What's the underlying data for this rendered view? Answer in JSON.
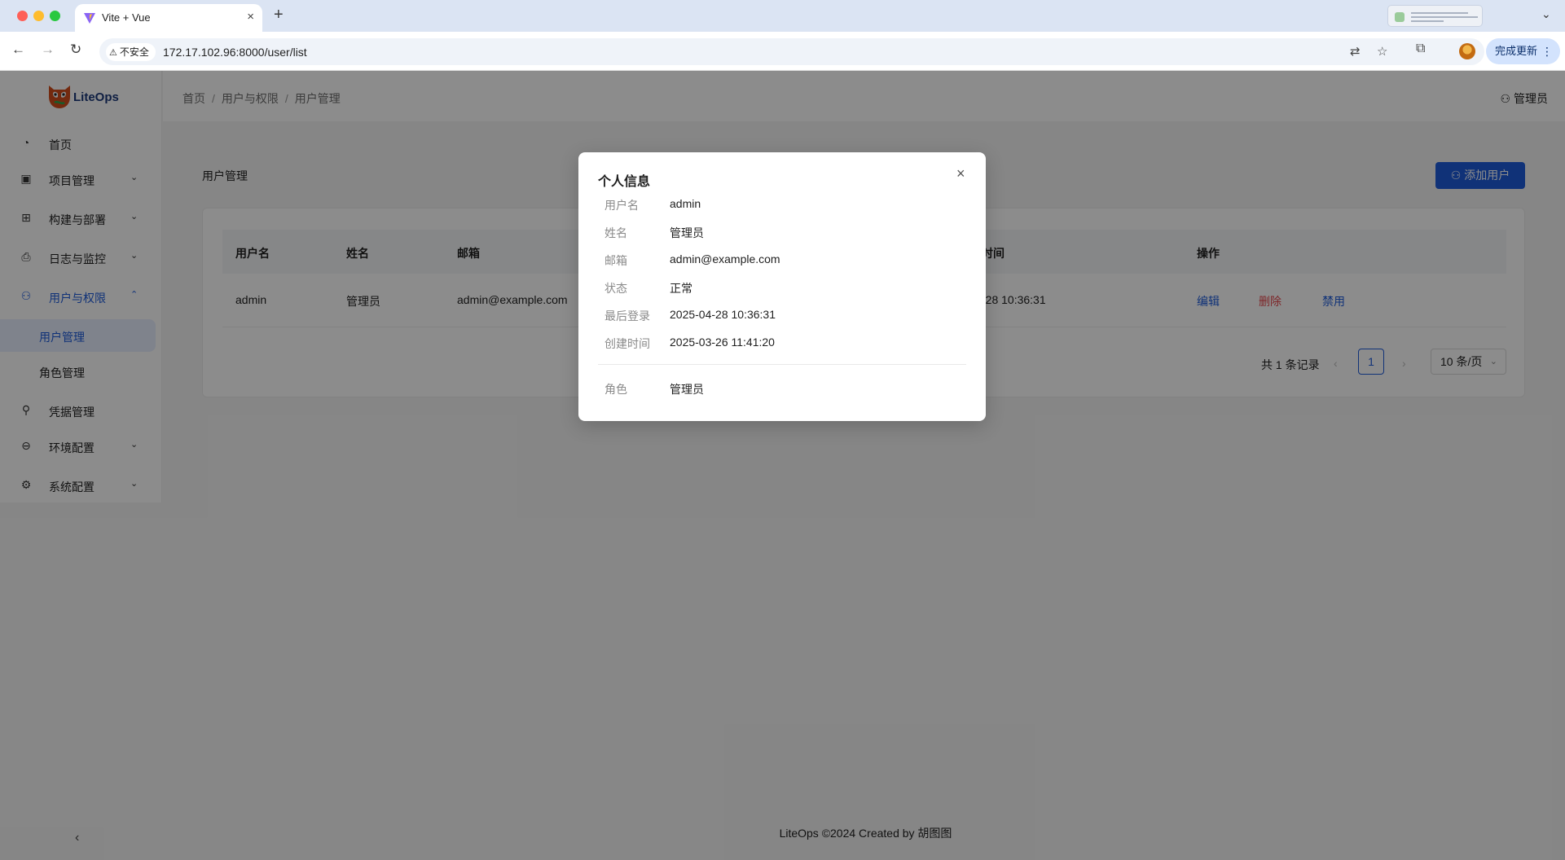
{
  "browser": {
    "tab_title": "Vite + Vue",
    "new_tab": "+",
    "tab_close": "×",
    "url": "172.17.102.96:8000/user/list",
    "insecure_label": "不安全",
    "update_label": "完成更新",
    "icons": [
      "back-icon",
      "forward-icon",
      "reload-icon",
      "translate-icon",
      "star-icon",
      "extensions-icon",
      "profile-icon",
      "menu-dots-icon"
    ]
  },
  "app": {
    "logo_text": "LiteOps",
    "breadcrumb": [
      "首页",
      "用户与权限",
      "用户管理"
    ],
    "breadcrumb_sep": "/",
    "user_menu": "管理员",
    "footer": "LiteOps ©2024 Created by 胡图图"
  },
  "sidebar": {
    "items": [
      {
        "label": "首页",
        "icon": "dashboard-icon"
      },
      {
        "label": "项目管理",
        "icon": "project-icon"
      },
      {
        "label": "构建与部署",
        "icon": "build-icon"
      },
      {
        "label": "日志与监控",
        "icon": "log-icon"
      },
      {
        "label": "用户与权限",
        "icon": "user-icon"
      },
      {
        "label": "凭据管理",
        "icon": "key-icon"
      },
      {
        "label": "环境配置",
        "icon": "environment-icon"
      },
      {
        "label": "系统配置",
        "icon": "settings-icon"
      }
    ],
    "subitems": [
      {
        "label": "用户管理",
        "selected": true
      },
      {
        "label": "角色管理",
        "selected": false
      }
    ]
  },
  "main": {
    "page_title": "用户管理",
    "add_button": "添加用户",
    "table": {
      "headers": [
        "用户名",
        "姓名",
        "邮箱",
        "时间",
        "操作"
      ],
      "rows": [
        {
          "username": "admin",
          "name": "管理员",
          "email": "admin@example.com",
          "time": "-28 10:36:31",
          "ops": [
            "编辑",
            "删除",
            "禁用"
          ]
        }
      ]
    },
    "pagination": {
      "total": "共 1 条记录",
      "prev": "‹",
      "current_page": "1",
      "next": "›",
      "page_size": "10 条/页"
    }
  },
  "modal": {
    "title": "个人信息",
    "close": "×",
    "fields": [
      {
        "label": "用户名",
        "value": "admin"
      },
      {
        "label": "姓名",
        "value": "管理员"
      },
      {
        "label": "邮箱",
        "value": "admin@example.com"
      },
      {
        "label": "状态",
        "value": "正常"
      },
      {
        "label": "最后登录",
        "value": "2025-04-28 10:36:31"
      },
      {
        "label": "创建时间",
        "value": "2025-03-26 11:41:20"
      }
    ],
    "role": {
      "label": "角色",
      "value": "管理员"
    }
  },
  "colors": {
    "primary": "#1e5bdb",
    "danger": "#e5484d",
    "mask": "rgba(0,0,0,0.45)"
  }
}
